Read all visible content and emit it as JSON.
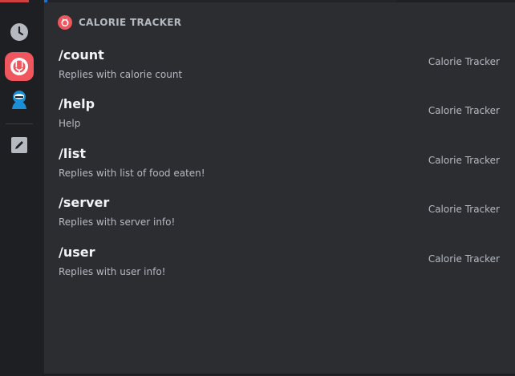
{
  "section": {
    "title": "CALORIE TRACKER"
  },
  "commands": [
    {
      "name": "/count",
      "description": "Replies with calorie count",
      "source": "Calorie Tracker"
    },
    {
      "name": "/help",
      "description": "Help",
      "source": "Calorie Tracker"
    },
    {
      "name": "/list",
      "description": "Replies with list of food eaten!",
      "source": "Calorie Tracker"
    },
    {
      "name": "/server",
      "description": "Replies with server info!",
      "source": "Calorie Tracker"
    },
    {
      "name": "/user",
      "description": "Replies with user info!",
      "source": "Calorie Tracker"
    }
  ],
  "rail": {
    "items": [
      {
        "icon": "clock-icon"
      },
      {
        "icon": "calorie-tracker-app-icon"
      },
      {
        "icon": "bot-avatar-icon"
      },
      {
        "icon": "pencil-icon"
      }
    ]
  },
  "colors": {
    "accent": "#f0565e",
    "panel": "#2b2d31",
    "rail": "#1e1f22"
  }
}
